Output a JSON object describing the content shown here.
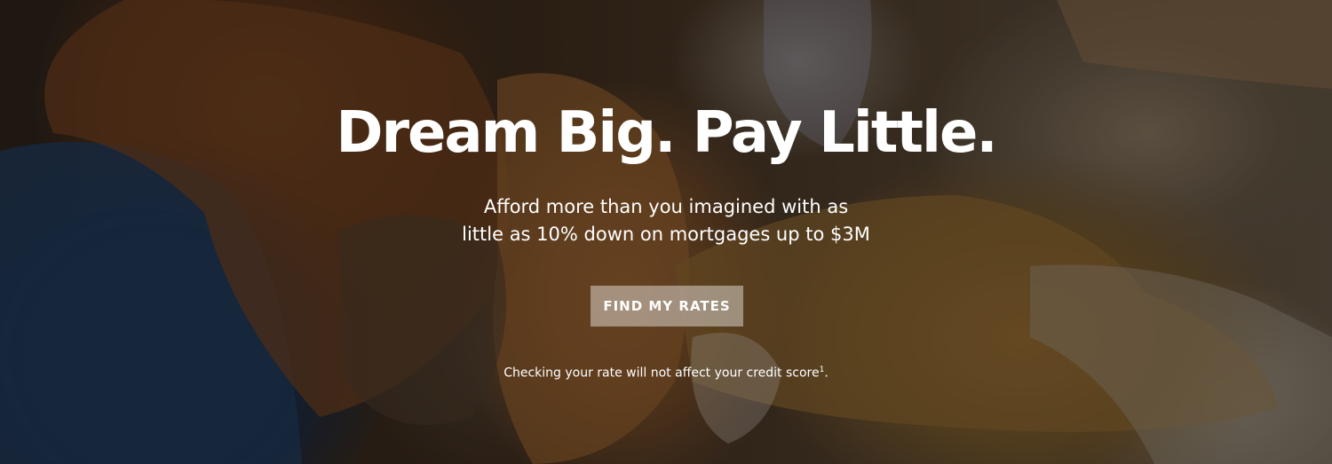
{
  "hero": {
    "headline": "Dream Big. Pay Little.",
    "subtitle_line1": "Afford more than you imagined with as",
    "subtitle_line2": "little as 10% down on mortgages up to $3M",
    "cta_label": "FIND MY RATES",
    "disclaimer_text": "Checking your rate will not affect your credit score",
    "disclaimer_footnote": "1",
    "disclaimer_end": "."
  },
  "colors": {
    "text": "#ffffff",
    "button_bg": "rgba(255,255,255,0.42)"
  }
}
